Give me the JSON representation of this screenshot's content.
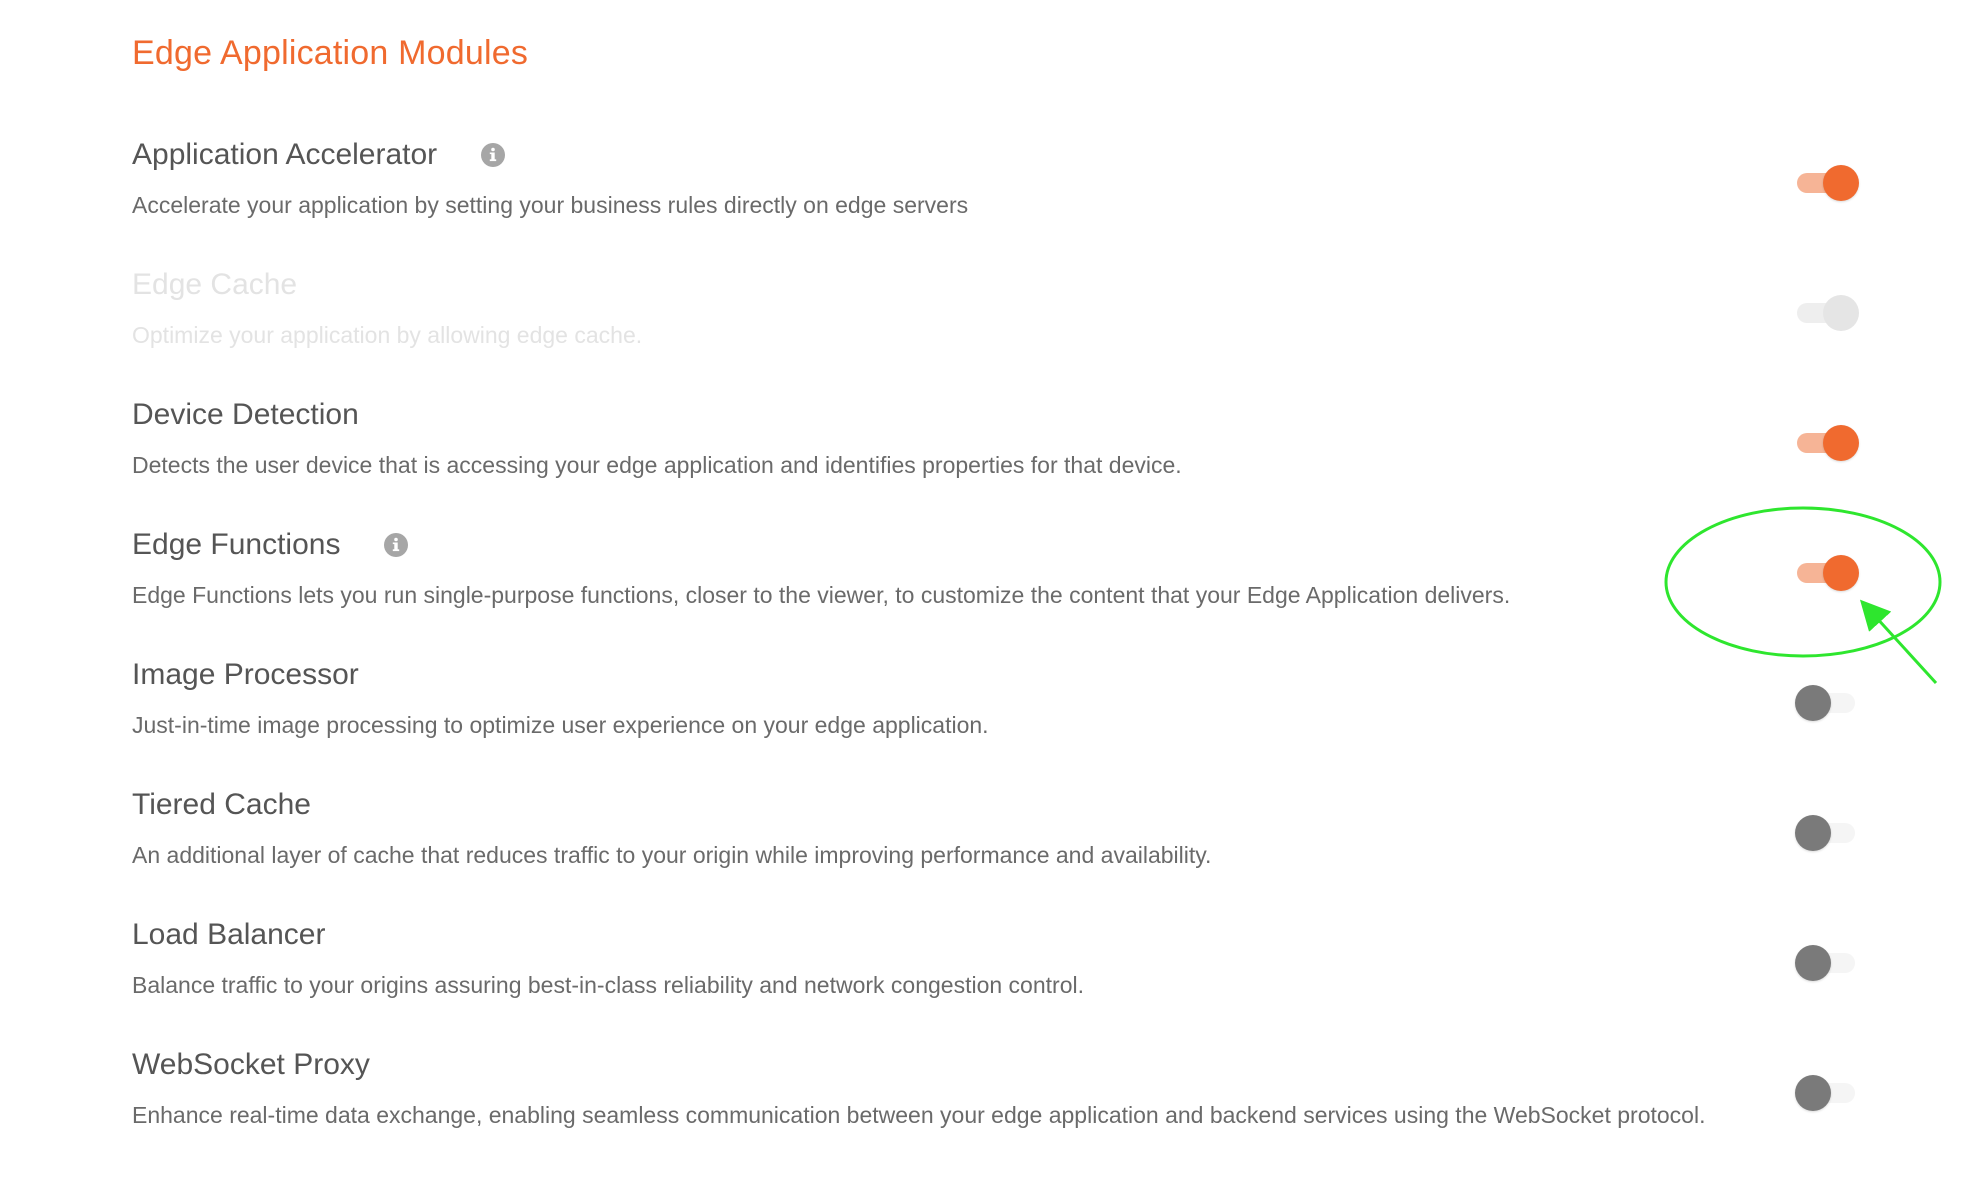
{
  "title": "Edge Application Modules",
  "colors": {
    "accent": "#f06a2f",
    "track_on": "#f6b496",
    "knob_off": "#7a7a7a",
    "annotation": "#2ee62e"
  },
  "modules": [
    {
      "title": "Application Accelerator",
      "description": "Accelerate your application by setting your business rules directly on edge servers",
      "info_icon": "info-icon",
      "state": "on"
    },
    {
      "title": "Edge Cache",
      "description": "Optimize your application by allowing edge cache.",
      "state": "disabled"
    },
    {
      "title": "Device Detection",
      "description": "Detects the user device that is accessing your edge application and identifies properties for that device.",
      "state": "on"
    },
    {
      "title": "Edge Functions",
      "description": "Edge Functions lets you run single-purpose functions, closer to the viewer, to customize the content that your Edge Application delivers.",
      "info_icon": "info-icon",
      "state": "on"
    },
    {
      "title": "Image Processor",
      "description": "Just-in-time image processing to optimize user experience on your edge application.",
      "state": "off"
    },
    {
      "title": "Tiered Cache",
      "description": "An additional layer of cache that reduces traffic to your origin while improving performance and availability.",
      "state": "off"
    },
    {
      "title": "Load Balancer",
      "description": "Balance traffic to your origins assuring best-in-class reliability and network congestion control.",
      "state": "off"
    },
    {
      "title": "WebSocket Proxy",
      "description": "Enhance real-time data exchange, enabling seamless communication between your edge application and backend services using the WebSocket protocol.",
      "state": "off"
    }
  ]
}
